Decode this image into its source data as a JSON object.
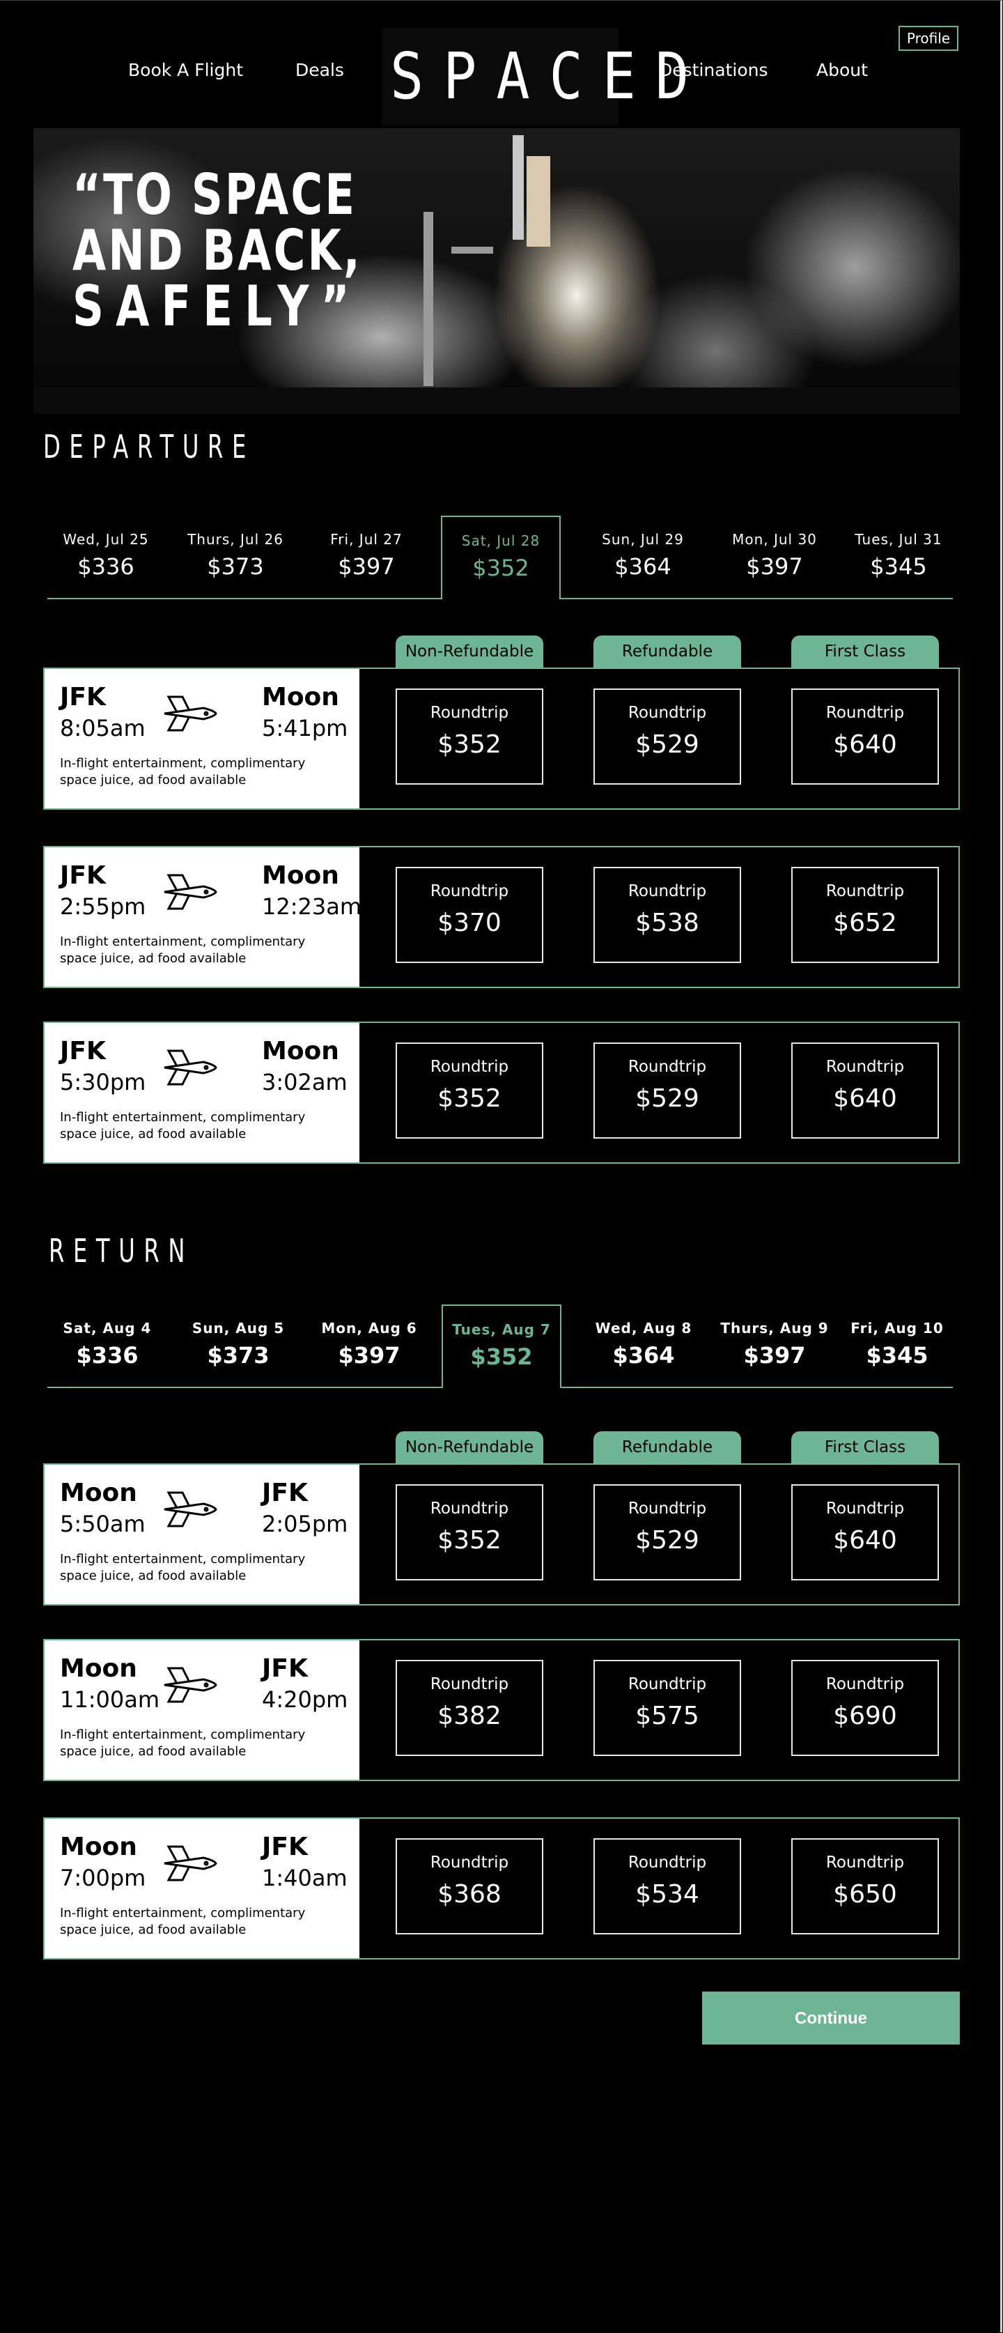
{
  "header": {
    "nav": [
      "Book A Flight",
      "Deals",
      "Destinations",
      "About"
    ],
    "logo": "SPACED",
    "profile_label": "Profile"
  },
  "hero": {
    "quote_lines": [
      "“TO SPACE",
      "AND BACK,",
      "SAFELY”"
    ]
  },
  "departure": {
    "title": "DEPARTURE",
    "dates": [
      {
        "label": "Wed, Jul 25",
        "price": "$336"
      },
      {
        "label": "Thurs, Jul 26",
        "price": "$373"
      },
      {
        "label": "Fri, Jul 27",
        "price": "$397"
      },
      {
        "label": "Sat, Jul 28",
        "price": "$352"
      },
      {
        "label": "Sun, Jul 29",
        "price": "$364"
      },
      {
        "label": "Mon, Jul 30",
        "price": "$397"
      },
      {
        "label": "Tues, Jul 31",
        "price": "$345"
      }
    ],
    "selected_index": 3,
    "fare_types": [
      "Non-Refundable",
      "Refundable",
      "First Class"
    ],
    "flights": [
      {
        "from": "JFK",
        "dep": "8:05am",
        "to": "Moon",
        "arr": "5:41pm",
        "amenities": "In-flight entertainment, complimentary space juice, ad food available",
        "fares": [
          {
            "type": "Roundtrip",
            "price": "$352"
          },
          {
            "type": "Roundtrip",
            "price": "$529"
          },
          {
            "type": "Roundtrip",
            "price": "$640"
          }
        ]
      },
      {
        "from": "JFK",
        "dep": "2:55pm",
        "to": "Moon",
        "arr": "12:23am",
        "amenities": "In-flight entertainment, complimentary space juice, ad food available",
        "fares": [
          {
            "type": "Roundtrip",
            "price": "$370"
          },
          {
            "type": "Roundtrip",
            "price": "$538"
          },
          {
            "type": "Roundtrip",
            "price": "$652"
          }
        ]
      },
      {
        "from": "JFK",
        "dep": "5:30pm",
        "to": "Moon",
        "arr": "3:02am",
        "amenities": "In-flight entertainment, complimentary space juice, ad food available",
        "fares": [
          {
            "type": "Roundtrip",
            "price": "$352"
          },
          {
            "type": "Roundtrip",
            "price": "$529"
          },
          {
            "type": "Roundtrip",
            "price": "$640"
          }
        ]
      }
    ]
  },
  "return": {
    "title": "RETURN",
    "dates": [
      {
        "label": "Sat, Aug 4",
        "price": "$336"
      },
      {
        "label": "Sun, Aug 5",
        "price": "$373"
      },
      {
        "label": "Mon, Aug 6",
        "price": "$397"
      },
      {
        "label": "Tues, Aug 7",
        "price": "$352"
      },
      {
        "label": "Wed, Aug 8",
        "price": "$364"
      },
      {
        "label": "Thurs, Aug 9",
        "price": "$397"
      },
      {
        "label": "Fri, Aug 10",
        "price": "$345"
      }
    ],
    "selected_index": 3,
    "fare_types": [
      "Non-Refundable",
      "Refundable",
      "First Class"
    ],
    "flights": [
      {
        "from": "Moon",
        "dep": "5:50am",
        "to": "JFK",
        "arr": "2:05pm",
        "amenities": "In-flight entertainment, complimentary space juice, ad food available",
        "fares": [
          {
            "type": "Roundtrip",
            "price": "$352"
          },
          {
            "type": "Roundtrip",
            "price": "$529"
          },
          {
            "type": "Roundtrip",
            "price": "$640"
          }
        ]
      },
      {
        "from": "Moon",
        "dep": "11:00am",
        "to": "JFK",
        "arr": "4:20pm",
        "amenities": "In-flight entertainment, complimentary space juice, ad food available",
        "fares": [
          {
            "type": "Roundtrip",
            "price": "$382"
          },
          {
            "type": "Roundtrip",
            "price": "$575"
          },
          {
            "type": "Roundtrip",
            "price": "$690"
          }
        ]
      },
      {
        "from": "Moon",
        "dep": "7:00pm",
        "to": "JFK",
        "arr": "1:40am",
        "amenities": "In-flight entertainment, complimentary space juice, ad food available",
        "fares": [
          {
            "type": "Roundtrip",
            "price": "$368"
          },
          {
            "type": "Roundtrip",
            "price": "$534"
          },
          {
            "type": "Roundtrip",
            "price": "$650"
          }
        ]
      }
    ]
  },
  "continue_label": "Continue",
  "colors": {
    "accent": "#6db594",
    "background": "#000000",
    "card": "#ffffff"
  }
}
